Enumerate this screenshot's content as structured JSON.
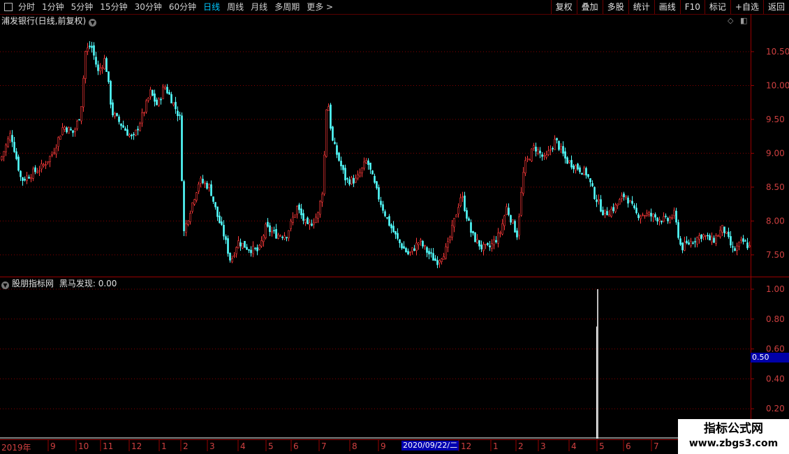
{
  "toolbar": {
    "periods": [
      "分时",
      "1分钟",
      "5分钟",
      "15分钟",
      "30分钟",
      "60分钟",
      "日线",
      "周线",
      "月线",
      "多周期",
      "更多 >"
    ],
    "active_period": "日线",
    "buttons": [
      "复权",
      "叠加",
      "多股",
      "统计",
      "画线",
      "F10",
      "标记",
      "+自选",
      "返回"
    ]
  },
  "main_panel": {
    "title": "浦发银行(日线,前复权)",
    "y_ticks": [
      "10.50",
      "10.00",
      "9.50",
      "9.00",
      "8.50",
      "8.00",
      "7.50"
    ]
  },
  "indicator_panel": {
    "title": "股朋指标网",
    "label": "黑马发现:",
    "value": "0.00",
    "y_ticks": [
      "1.00",
      "0.80",
      "0.60",
      "0.40",
      "0.20"
    ],
    "marker_value": "0.50"
  },
  "date_axis": {
    "labels": [
      "2019年",
      "9",
      "10",
      "11",
      "12",
      "1",
      "2",
      "3",
      "4",
      "5",
      "6",
      "7",
      "8",
      "9",
      "12",
      "1",
      "2",
      "3",
      "4",
      "5",
      "6",
      "7"
    ],
    "highlight": "2020/09/22/二"
  },
  "watermark": {
    "title": "指标公式网",
    "url": "www.zbgs3.com"
  },
  "colors": {
    "up": "#ff3a3a",
    "down": "#54ffff",
    "grid": "#8a0000",
    "axis_text": "#d04040",
    "highlight": "#0000b0"
  },
  "chart_data": [
    {
      "type": "candlestick",
      "title": "浦发银行(日线,前复权)",
      "ylim": [
        7.2,
        10.85
      ],
      "x_period": "2019年8月 - 2021年8月",
      "close_points": [
        [
          0,
          8.9
        ],
        [
          15,
          9.3
        ],
        [
          30,
          8.6
        ],
        [
          45,
          8.7
        ],
        [
          60,
          8.8
        ],
        [
          75,
          9.0
        ],
        [
          90,
          9.4
        ],
        [
          105,
          9.3
        ],
        [
          115,
          9.6
        ],
        [
          122,
          10.5
        ],
        [
          130,
          10.6
        ],
        [
          140,
          10.2
        ],
        [
          150,
          10.4
        ],
        [
          160,
          9.6
        ],
        [
          175,
          9.4
        ],
        [
          190,
          9.2
        ],
        [
          205,
          9.6
        ],
        [
          215,
          9.9
        ],
        [
          225,
          9.7
        ],
        [
          235,
          10.0
        ],
        [
          245,
          9.8
        ],
        [
          258,
          9.5
        ],
        [
          262,
          7.8
        ],
        [
          270,
          8.1
        ],
        [
          285,
          8.6
        ],
        [
          300,
          8.5
        ],
        [
          310,
          8.1
        ],
        [
          320,
          7.8
        ],
        [
          330,
          7.4
        ],
        [
          340,
          7.7
        ],
        [
          355,
          7.6
        ],
        [
          370,
          7.55
        ],
        [
          380,
          7.9
        ],
        [
          395,
          7.8
        ],
        [
          410,
          7.8
        ],
        [
          425,
          8.2
        ],
        [
          440,
          7.9
        ],
        [
          455,
          8.1
        ],
        [
          462,
          8.5
        ],
        [
          468,
          9.9
        ],
        [
          475,
          9.2
        ],
        [
          485,
          8.9
        ],
        [
          495,
          8.6
        ],
        [
          510,
          8.6
        ],
        [
          525,
          8.9
        ],
        [
          540,
          8.4
        ],
        [
          555,
          8.0
        ],
        [
          570,
          7.7
        ],
        [
          585,
          7.5
        ],
        [
          600,
          7.7
        ],
        [
          615,
          7.5
        ],
        [
          625,
          7.4
        ],
        [
          640,
          7.6
        ],
        [
          650,
          8.0
        ],
        [
          660,
          8.4
        ],
        [
          675,
          7.8
        ],
        [
          690,
          7.6
        ],
        [
          700,
          7.6
        ],
        [
          715,
          7.8
        ],
        [
          725,
          8.2
        ],
        [
          740,
          7.8
        ],
        [
          750,
          8.8
        ],
        [
          765,
          9.1
        ],
        [
          780,
          8.9
        ],
        [
          795,
          9.2
        ],
        [
          810,
          8.9
        ],
        [
          825,
          8.8
        ],
        [
          840,
          8.7
        ],
        [
          850,
          8.4
        ],
        [
          865,
          8.1
        ],
        [
          880,
          8.2
        ],
        [
          895,
          8.4
        ],
        [
          910,
          8.1
        ],
        [
          925,
          8.1
        ],
        [
          940,
          8.05
        ],
        [
          955,
          8.0
        ],
        [
          965,
          8.1
        ],
        [
          975,
          7.6
        ],
        [
          990,
          7.7
        ],
        [
          1005,
          7.8
        ],
        [
          1020,
          7.7
        ],
        [
          1035,
          7.9
        ],
        [
          1050,
          7.55
        ],
        [
          1063,
          7.7
        ],
        [
          1075,
          7.6
        ]
      ]
    },
    {
      "type": "bar",
      "title": "黑马发现",
      "ylim": [
        0,
        1.0
      ],
      "x_period": "2019年8月 - 2021年8月",
      "signals": [
        {
          "x_label": "5",
          "value": 1.0
        }
      ],
      "baseline": 0
    }
  ]
}
